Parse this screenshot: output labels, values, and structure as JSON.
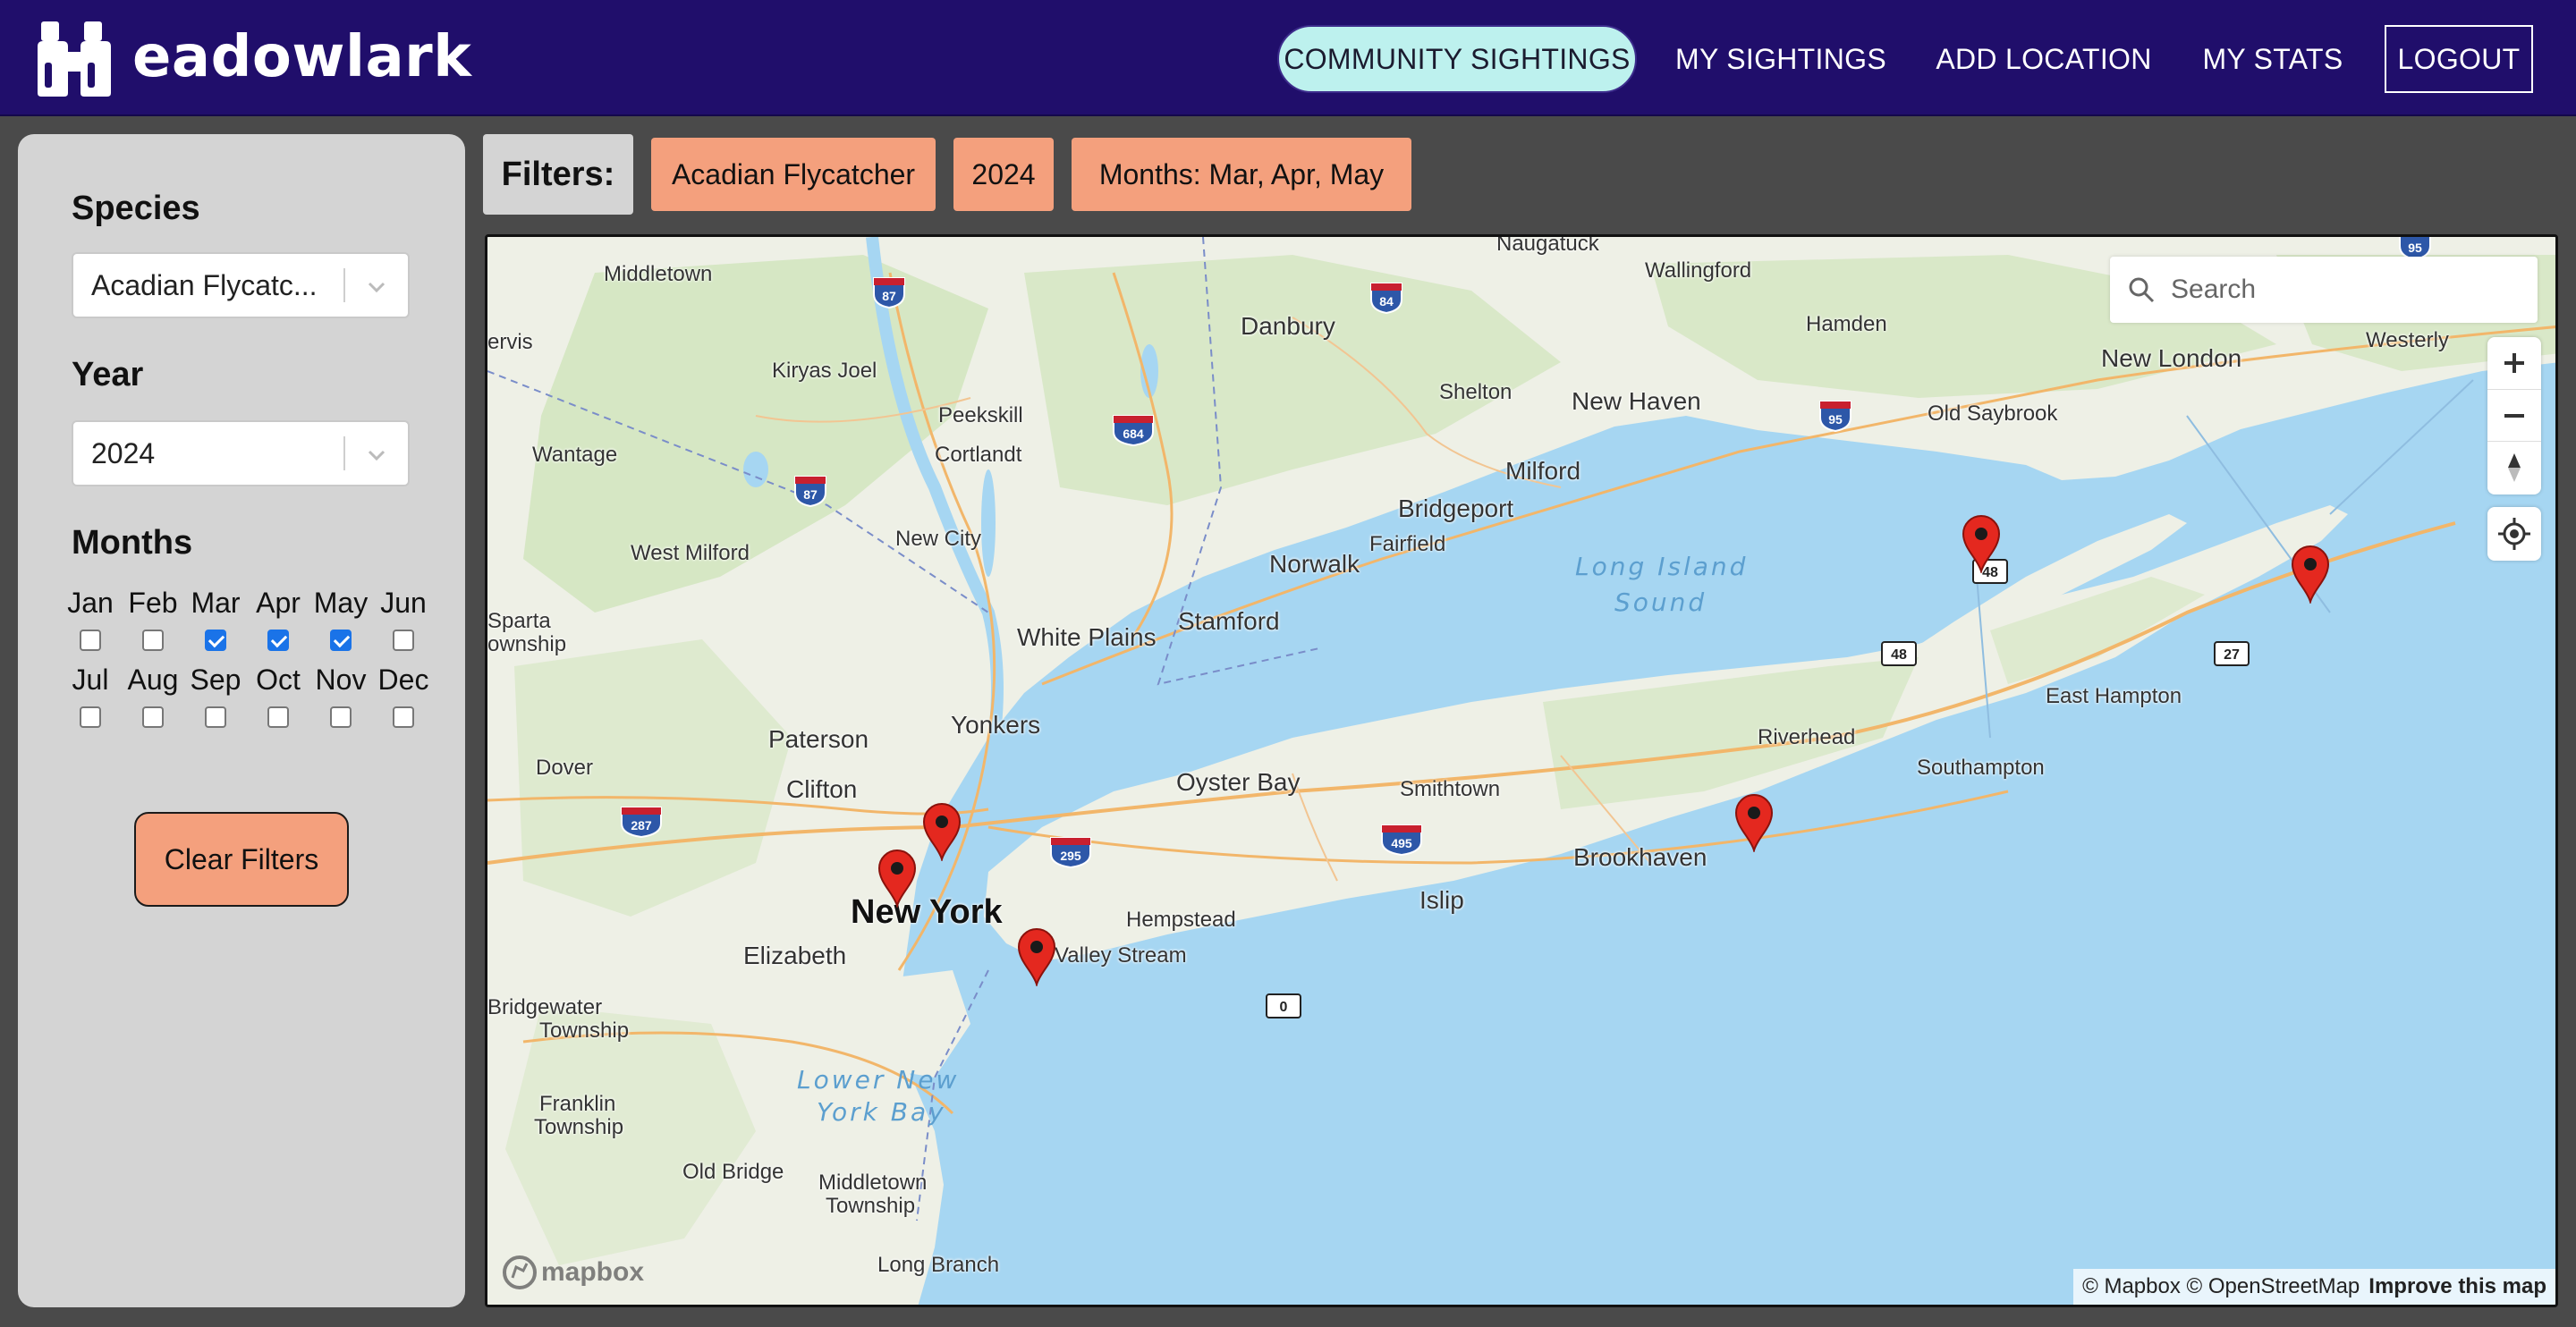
{
  "brand": {
    "name": "eadowlark",
    "icon": "binoculars-icon",
    "color": "#200e6b"
  },
  "nav": {
    "community": "COMMUNITY SIGHTINGS",
    "mine": "MY SIGHTINGS",
    "add": "ADD LOCATION",
    "stats": "MY STATS",
    "logout": "LOGOUT"
  },
  "sidebar": {
    "species_label": "Species",
    "species_value": "Acadian Flycatc...",
    "year_label": "Year",
    "year_value": "2024",
    "months_label": "Months",
    "months": [
      {
        "label": "Jan",
        "checked": false
      },
      {
        "label": "Feb",
        "checked": false
      },
      {
        "label": "Mar",
        "checked": true
      },
      {
        "label": "Apr",
        "checked": true
      },
      {
        "label": "May",
        "checked": true
      },
      {
        "label": "Jun",
        "checked": false
      },
      {
        "label": "Jul",
        "checked": false
      },
      {
        "label": "Aug",
        "checked": false
      },
      {
        "label": "Sep",
        "checked": false
      },
      {
        "label": "Oct",
        "checked": false
      },
      {
        "label": "Nov",
        "checked": false
      },
      {
        "label": "Dec",
        "checked": false
      }
    ],
    "clear_label": "Clear Filters"
  },
  "filters": {
    "label": "Filters:",
    "chips": [
      "Acadian Flycatcher",
      "2024",
      "Months: Mar, Apr, May"
    ]
  },
  "map": {
    "search_placeholder": "Search",
    "attribution": "© Mapbox © OpenStreetMap",
    "improve": "Improve this map",
    "logo": "mapbox",
    "pin_color": "#e4281f",
    "places": {
      "naugatuck": "Naugatuck",
      "wallingford": "Wallingford",
      "middletown": "Middletown",
      "danbury": "Danbury",
      "hamden": "Hamden",
      "westerly": "Westerly",
      "ervis": "ervis",
      "kiryas_joel": "Kiryas Joel",
      "shelton": "Shelton",
      "new_haven": "New Haven",
      "new_london": "New London",
      "peekskill": "Peekskill",
      "cortlandt": "Cortlandt",
      "old_saybrook": "Old Saybrook",
      "wantage": "Wantage",
      "milford": "Milford",
      "bridgeport": "Bridgeport",
      "fairfield": "Fairfield",
      "new_city": "New City",
      "west_milford": "West Milford",
      "norwalk": "Norwalk",
      "sparta": "Sparta",
      "ownship": "ownship",
      "white_plains": "White Plains",
      "stamford": "Stamford",
      "east_hampton": "East Hampton",
      "yonkers": "Yonkers",
      "paterson": "Paterson",
      "riverhead": "Riverhead",
      "dover": "Dover",
      "southampton": "Southampton",
      "oyster_bay": "Oyster Bay",
      "clifton": "Clifton",
      "smithtown": "Smithtown",
      "brookhaven": "Brookhaven",
      "new_york": "New York",
      "islip": "Islip",
      "hempstead": "Hempstead",
      "elizabeth": "Elizabeth",
      "valley_stream": "Valley Stream",
      "bridgewater": "Bridgewater",
      "township": "Township",
      "franklin": "Franklin",
      "franklin_twp": "Township",
      "old_bridge": "Old Bridge",
      "middletown_nj": "Middletown",
      "middletown_twp": "Township",
      "long_branch": "Long Branch"
    },
    "water": {
      "lis_1": "Long Island",
      "lis_2": "Sound",
      "lny_1": "Lower New",
      "lny_2": "York Bay"
    },
    "shields": {
      "i87a": "87",
      "i84": "84",
      "i87b": "87",
      "i684": "684",
      "i95": "95",
      "r48a": "48",
      "r48b": "48",
      "r27": "27",
      "i287": "287",
      "i295": "295",
      "i495": "495",
      "r0": "0",
      "i95b": "95"
    }
  }
}
